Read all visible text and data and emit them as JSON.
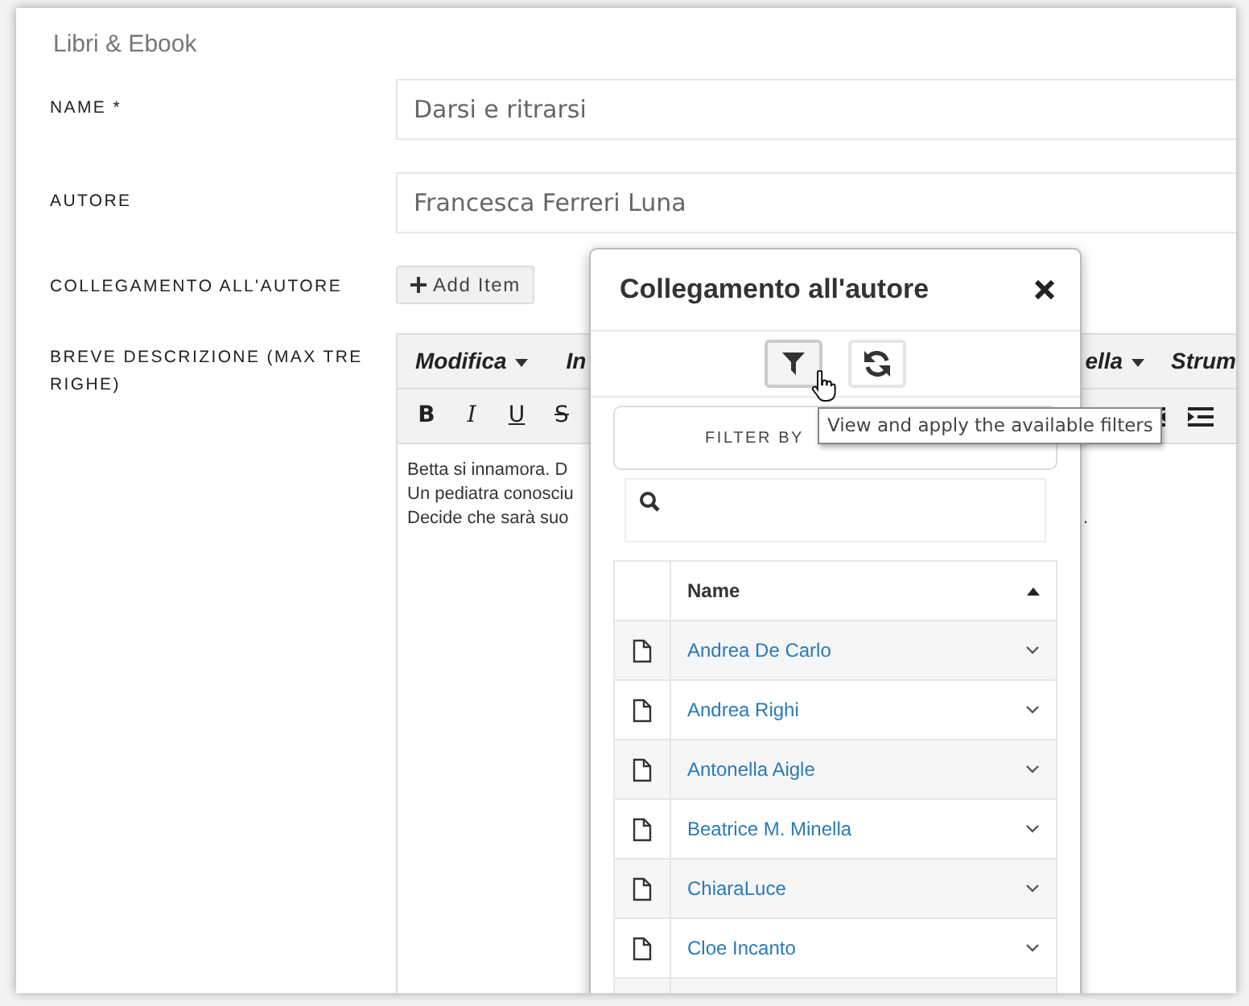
{
  "page_title": "Libri & Ebook",
  "fields": [
    {
      "kind": "text",
      "label": "NAME *",
      "value": "Darsi e ritrarsi"
    },
    {
      "kind": "text",
      "label": "AUTORE",
      "value": "Francesca Ferreri Luna"
    },
    {
      "kind": "add",
      "label": "COLLEGAMENTO ALL'AUTORE",
      "button": "Add Item"
    },
    {
      "kind": "editor",
      "label": "BREVE DESCRIZIONE (MAX TRE RIGHE)"
    }
  ],
  "editor": {
    "menus_left": [
      {
        "label": "Modifica",
        "caret": true
      },
      {
        "label": "In",
        "caret": false
      }
    ],
    "menus_right": [
      {
        "label": "ella",
        "caret": true
      },
      {
        "label": "Strum",
        "caret": false
      }
    ],
    "format_buttons": [
      {
        "kind": "bold",
        "label": "B"
      },
      {
        "kind": "italic",
        "label": "I"
      },
      {
        "kind": "underline",
        "label": "U"
      },
      {
        "kind": "strike",
        "label": "S"
      }
    ],
    "lines": [
      "Betta si innamora. D",
      "Un pediatra conosciu",
      "Decide che sarà suo"
    ],
    "fragment": "."
  },
  "popup": {
    "title": "Collegamento all'autore",
    "tools": [
      {
        "kind": "filter",
        "active": true
      },
      {
        "kind": "refresh",
        "active": false
      }
    ],
    "filter_by": "FILTER BY",
    "table": {
      "column": "Name",
      "sorted_ascending": true,
      "rows": [
        "Andrea De Carlo",
        "Andrea Righi",
        "Antonella Aigle",
        "Beatrice M. Minella",
        "ChiaraLuce",
        "Cloe Incanto"
      ]
    }
  },
  "tooltip": "View and apply the available filters"
}
